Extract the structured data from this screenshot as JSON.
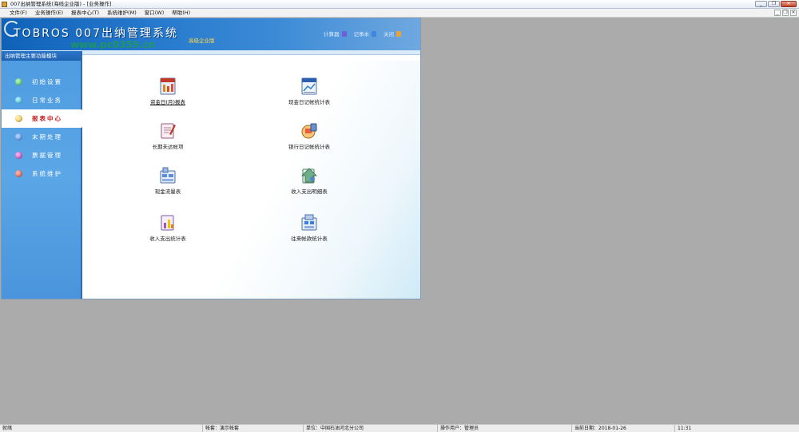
{
  "window": {
    "title": "007出纳管理系统(海线企业版) - [业务操作]",
    "buttons": [
      "_",
      "❐",
      "✕"
    ]
  },
  "menubar": {
    "items": [
      {
        "label": "文件(F)"
      },
      {
        "label": "业务操作(E)"
      },
      {
        "label": "报表中心(T)"
      },
      {
        "label": "系统维护(M)"
      },
      {
        "label": "窗口(W)"
      },
      {
        "label": "帮助(H)"
      }
    ],
    "mdi_buttons": [
      "_",
      "❐",
      "✕"
    ]
  },
  "header": {
    "brand": "TOBROS 007出纳管理系统",
    "edition": "高级企业版",
    "watermark": "www.pc0359.cn",
    "links": [
      {
        "label": "计算器",
        "icon": "calculator-icon",
        "color": "#6d5fd8"
      },
      {
        "label": "记事本",
        "icon": "notepad-icon",
        "color": "#3f86e0"
      },
      {
        "label": "关闭",
        "icon": "close-app-icon",
        "color": "#e8a23a"
      }
    ]
  },
  "sidebar": {
    "title": "出纳管理主要功能模块",
    "items": [
      {
        "label": "初始设置",
        "color": "#3cc25a",
        "active": false
      },
      {
        "label": "日常业务",
        "color": "#25b7d8",
        "active": false
      },
      {
        "label": "报表中心",
        "color": "#f0c03c",
        "active": true
      },
      {
        "label": "末期处理",
        "color": "#3a7fe0",
        "active": false
      },
      {
        "label": "票据管理",
        "color": "#c03ab8",
        "active": false
      },
      {
        "label": "系统维护",
        "color": "#e04a3a",
        "active": false
      }
    ]
  },
  "reports": [
    {
      "label": "资金日(月)报表",
      "icon": "fund-report-icon"
    },
    {
      "label": "现金日记帐统计表",
      "icon": "cash-journal-icon"
    },
    {
      "label": "长期未达帐项",
      "icon": "outstanding-items-icon"
    },
    {
      "label": "银行日记帐统计表",
      "icon": "bank-journal-icon"
    },
    {
      "label": "现金流量表",
      "icon": "cash-flow-icon"
    },
    {
      "label": "收入支出明细表",
      "icon": "income-expense-detail-icon"
    },
    {
      "label": "收入支出统计表",
      "icon": "income-expense-stats-icon"
    },
    {
      "label": "往来帐款统计表",
      "icon": "accounts-stats-icon"
    }
  ],
  "statusbar": {
    "ready": "就绪",
    "account_set": "帐套：演示帐套",
    "company": "单位：中国石油河北分公司",
    "operator": "操作用户：管理员",
    "date": "当前日期：2018-01-26",
    "time": "11:31"
  }
}
